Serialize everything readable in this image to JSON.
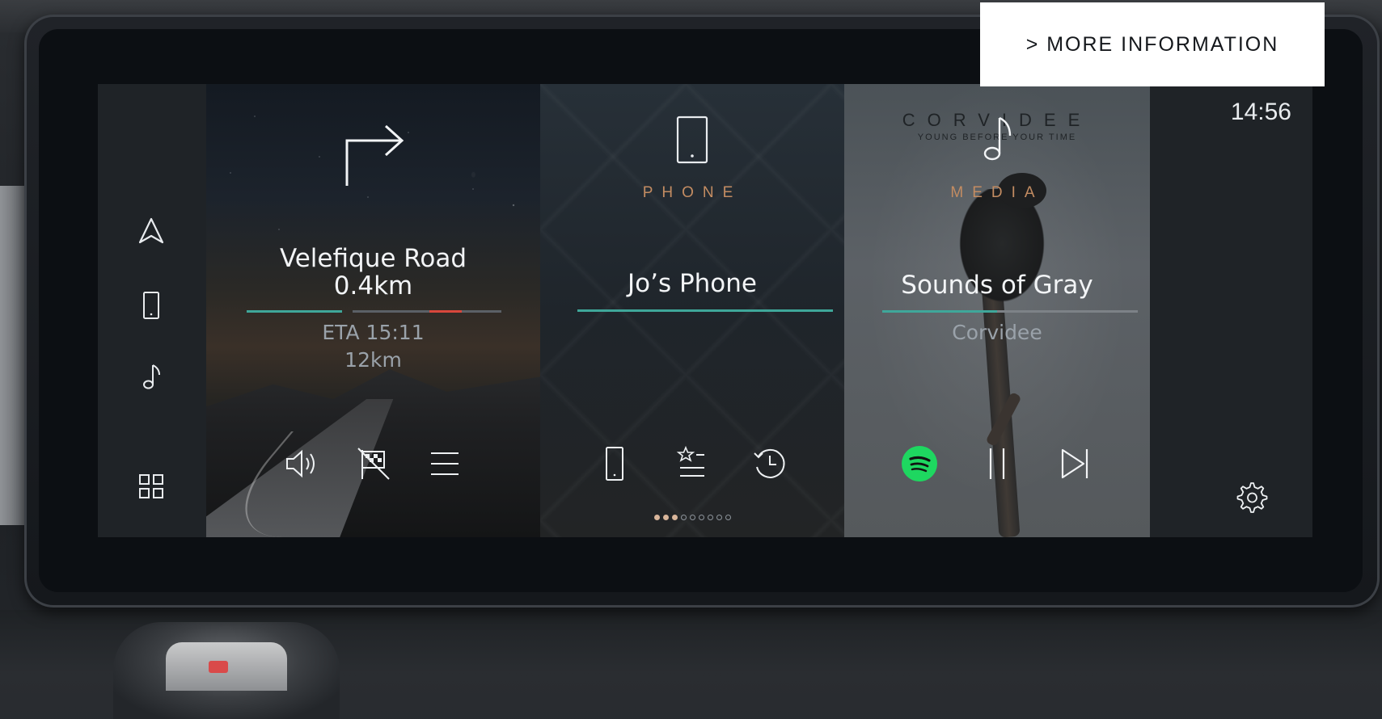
{
  "more_info": {
    "label": "> MORE INFORMATION"
  },
  "clock": {
    "time": "14:56"
  },
  "sidebar": {
    "items": [
      {
        "icon": "navigation-arrow-icon"
      },
      {
        "icon": "phone-icon"
      },
      {
        "icon": "music-note-icon"
      },
      {
        "icon": "app-grid-icon"
      }
    ]
  },
  "navigation": {
    "turn_icon": "turn-right-icon",
    "street": "Velefique Road",
    "distance": "0.4km",
    "eta": "ETA 15:11",
    "total_distance": "12km",
    "progress": 0.4,
    "controls": [
      "volume-icon",
      "cancel-route-icon",
      "menu-icon"
    ]
  },
  "phone": {
    "section_label": "PHONE",
    "device": "Jo’s Phone",
    "controls": [
      "phone-keypad-icon",
      "favourites-icon",
      "recents-icon"
    ],
    "page_dots": {
      "total": 9,
      "active": 3
    }
  },
  "media": {
    "section_label": "MEDIA",
    "track": "Sounds of Gray",
    "artist": "Corvidee",
    "album_brand": "CORVIDEE",
    "album_tagline": "YOUNG BEFORE YOUR TIME",
    "progress": 0.45,
    "controls": [
      "spotify-icon",
      "pause-icon",
      "skip-next-icon"
    ]
  },
  "colors": {
    "accent_teal": "#3fa79a",
    "accent_copper": "#c38c62",
    "alert_red": "#d8473c",
    "spotify_green": "#1ed760"
  }
}
